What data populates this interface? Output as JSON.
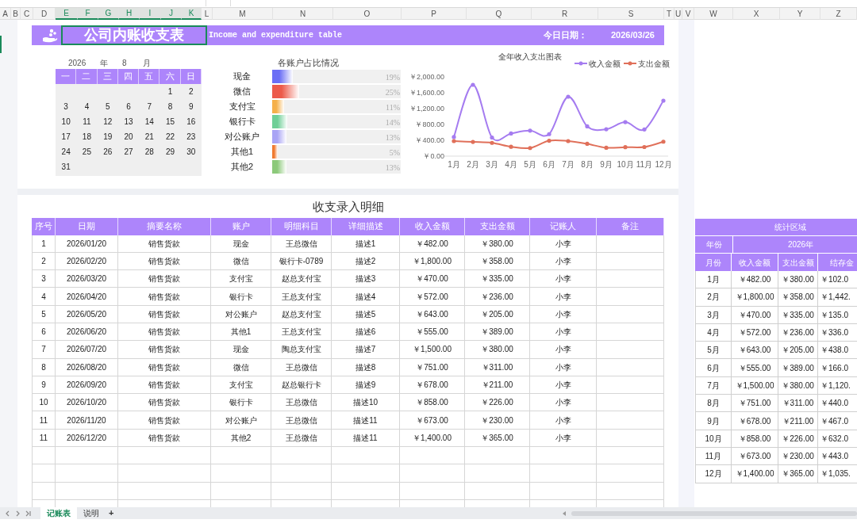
{
  "column_headers": [
    {
      "label": "A",
      "selected": false
    },
    {
      "label": "B",
      "selected": false
    },
    {
      "label": "C",
      "selected": false
    },
    {
      "label": "D",
      "selected": false
    },
    {
      "label": "E",
      "selected": true
    },
    {
      "label": "F",
      "selected": true
    },
    {
      "label": "G",
      "selected": true
    },
    {
      "label": "H",
      "selected": true
    },
    {
      "label": "I",
      "selected": true
    },
    {
      "label": "J",
      "selected": true
    },
    {
      "label": "K",
      "selected": true
    },
    {
      "label": "L",
      "selected": false
    },
    {
      "label": "M",
      "selected": false
    },
    {
      "label": "N",
      "selected": false
    },
    {
      "label": "O",
      "selected": false
    },
    {
      "label": "P",
      "selected": false
    },
    {
      "label": "Q",
      "selected": false
    },
    {
      "label": "R",
      "selected": false
    },
    {
      "label": "S",
      "selected": false
    },
    {
      "label": "T",
      "selected": false
    },
    {
      "label": "U",
      "selected": false
    },
    {
      "label": "V",
      "selected": false
    },
    {
      "label": "W",
      "selected": false
    },
    {
      "label": "X",
      "selected": false
    },
    {
      "label": "Y",
      "selected": false
    },
    {
      "label": "Z",
      "selected": false
    }
  ],
  "header": {
    "title": "公司内账收支表",
    "subtitle": "Income and expenditure table",
    "date_label": "今日日期：",
    "date": "2026/03/26"
  },
  "calendar": {
    "year": "2026",
    "year_unit": "年",
    "month": "8",
    "month_unit": "月",
    "weekdays": [
      "一",
      "二",
      "三",
      "四",
      "五",
      "六",
      "日"
    ],
    "days": [
      "1",
      "2",
      "3",
      "4",
      "5",
      "6",
      "7",
      "8",
      "9",
      "10",
      "11",
      "12",
      "13",
      "14",
      "15",
      "16",
      "17",
      "18",
      "19",
      "20",
      "21",
      "22",
      "23",
      "24",
      "25",
      "26",
      "27",
      "28",
      "29",
      "30",
      "31"
    ]
  },
  "account_share": {
    "title": "各账户占比情况",
    "rows": [
      {
        "label": "现金",
        "level": 0.19,
        "reading": "19%",
        "color": "#6b6ef5"
      },
      {
        "label": "微信",
        "level": 0.25,
        "reading": "25%",
        "color": "#ec5a4a"
      },
      {
        "label": "支付宝",
        "level": 0.11,
        "reading": "11%",
        "color": "#f5b04a"
      },
      {
        "label": "银行卡",
        "level": 0.14,
        "reading": "14%",
        "color": "#6fcf97"
      },
      {
        "label": "对公账户",
        "level": 0.13,
        "reading": "13%",
        "color": "#a9a4f5"
      },
      {
        "label": "其他1",
        "level": 0.05,
        "reading": "5%",
        "color": "#f07a30"
      },
      {
        "label": "其他2",
        "level": 0.13,
        "reading": "13%",
        "color": "#8cc97a"
      }
    ]
  },
  "year_chart": {
    "chart_data": {
      "type": "line",
      "title": "全年收入支出图表",
      "categories": [
        "1月",
        "2月",
        "3月",
        "4月",
        "5月",
        "6月",
        "7月",
        "8月",
        "9月",
        "10月",
        "11月",
        "12月"
      ],
      "series": [
        {
          "name": "收入金额",
          "color": "#a57cf0",
          "values": [
            482,
            1800,
            470,
            572,
            643,
            555,
            1500,
            751,
            678,
            858,
            673,
            1400
          ]
        },
        {
          "name": "支出金额",
          "color": "#e0705a",
          "values": [
            380,
            358,
            335,
            236,
            205,
            389,
            380,
            311,
            211,
            226,
            230,
            365
          ]
        }
      ],
      "legend": "top-right",
      "ylim": [
        0,
        2000
      ],
      "yticks": [
        {
          "value": 0,
          "label": "￥0.00"
        },
        {
          "value": 400,
          "label": "￥400.00"
        },
        {
          "value": 800,
          "label": "￥800.00"
        },
        {
          "value": 1200,
          "label": "￥1,200.00"
        },
        {
          "value": 1600,
          "label": "￥1,600.00"
        },
        {
          "value": 2000,
          "label": "￥2,000.00"
        }
      ]
    }
  },
  "detail": {
    "title": "收支录入明细",
    "columns": [
      "序号",
      "日期",
      "摘要名称",
      "账户",
      "明细科目",
      "详细描述",
      "收入金额",
      "支出金额",
      "记账人",
      "备注"
    ],
    "rows": [
      [
        "1",
        "2026/01/20",
        "销售货款",
        "现金",
        "王总微信",
        "描述1",
        "￥482.00",
        "￥380.00",
        "小李"
      ],
      [
        "2",
        "2026/02/20",
        "销售货款",
        "微信",
        "银行卡-0789",
        "描述2",
        "￥1,800.00",
        "￥358.00",
        "小李"
      ],
      [
        "3",
        "2026/03/20",
        "销售货款",
        "支付宝",
        "赵总支付宝",
        "描述3",
        "￥470.00",
        "￥335.00",
        "小李"
      ],
      [
        "4",
        "2026/04/20",
        "销售货款",
        "银行卡",
        "王总支付宝",
        "描述4",
        "￥572.00",
        "￥236.00",
        "小李"
      ],
      [
        "5",
        "2026/05/20",
        "销售货款",
        "对公账户",
        "赵总支付宝",
        "描述5",
        "￥643.00",
        "￥205.00",
        "小李"
      ],
      [
        "6",
        "2026/06/20",
        "销售货款",
        "其他1",
        "王总支付宝",
        "描述6",
        "￥555.00",
        "￥389.00",
        "小李"
      ],
      [
        "7",
        "2026/07/20",
        "销售货款",
        "现金",
        "陶总支付宝",
        "描述7",
        "￥1,500.00",
        "￥380.00",
        "小李"
      ],
      [
        "8",
        "2026/08/20",
        "销售货款",
        "微信",
        "王总微信",
        "描述8",
        "￥751.00",
        "￥311.00",
        "小李"
      ],
      [
        "9",
        "2026/09/20",
        "销售货款",
        "支付宝",
        "赵总银行卡",
        "描述9",
        "￥678.00",
        "￥211.00",
        "小李"
      ],
      [
        "10",
        "2026/10/20",
        "销售货款",
        "银行卡",
        "王总微信",
        "描述10",
        "￥858.00",
        "￥226.00",
        "小李"
      ],
      [
        "11",
        "2026/11/20",
        "销售货款",
        "对公账户",
        "王总微信",
        "描述11",
        "￥673.00",
        "￥230.00",
        "小李"
      ],
      [
        "11",
        "2026/12/20",
        "销售货款",
        "其他2",
        "王总微信",
        "描述11",
        "￥1,400.00",
        "￥365.00",
        "小李"
      ]
    ]
  },
  "stats": {
    "title": "统计区域",
    "year_label": "年份",
    "year": "2026年",
    "columns": [
      "月份",
      "收入金额",
      "支出金额",
      "结存金"
    ],
    "rows": [
      [
        "1月",
        "￥482.00",
        "￥380.00",
        "￥102.0"
      ],
      [
        "2月",
        "￥1,800.00",
        "￥358.00",
        "￥1,442."
      ],
      [
        "3月",
        "￥470.00",
        "￥335.00",
        "￥135.0"
      ],
      [
        "4月",
        "￥572.00",
        "￥236.00",
        "￥336.0"
      ],
      [
        "5月",
        "￥643.00",
        "￥205.00",
        "￥438.0"
      ],
      [
        "6月",
        "￥555.00",
        "￥389.00",
        "￥166.0"
      ],
      [
        "7月",
        "￥1,500.00",
        "￥380.00",
        "￥1,120."
      ],
      [
        "8月",
        "￥751.00",
        "￥311.00",
        "￥440.0"
      ],
      [
        "9月",
        "￥678.00",
        "￥211.00",
        "￥467.0"
      ],
      [
        "10月",
        "￥858.00",
        "￥226.00",
        "￥632.0"
      ],
      [
        "11月",
        "￥673.00",
        "￥230.00",
        "￥443.0"
      ],
      [
        "12月",
        "￥1,400.00",
        "￥365.00",
        "￥1,035."
      ]
    ]
  },
  "sheet_tabs": [
    {
      "label": "记账表",
      "selected": true
    },
    {
      "label": "说明",
      "selected": false
    }
  ],
  "add_sheet": "+"
}
